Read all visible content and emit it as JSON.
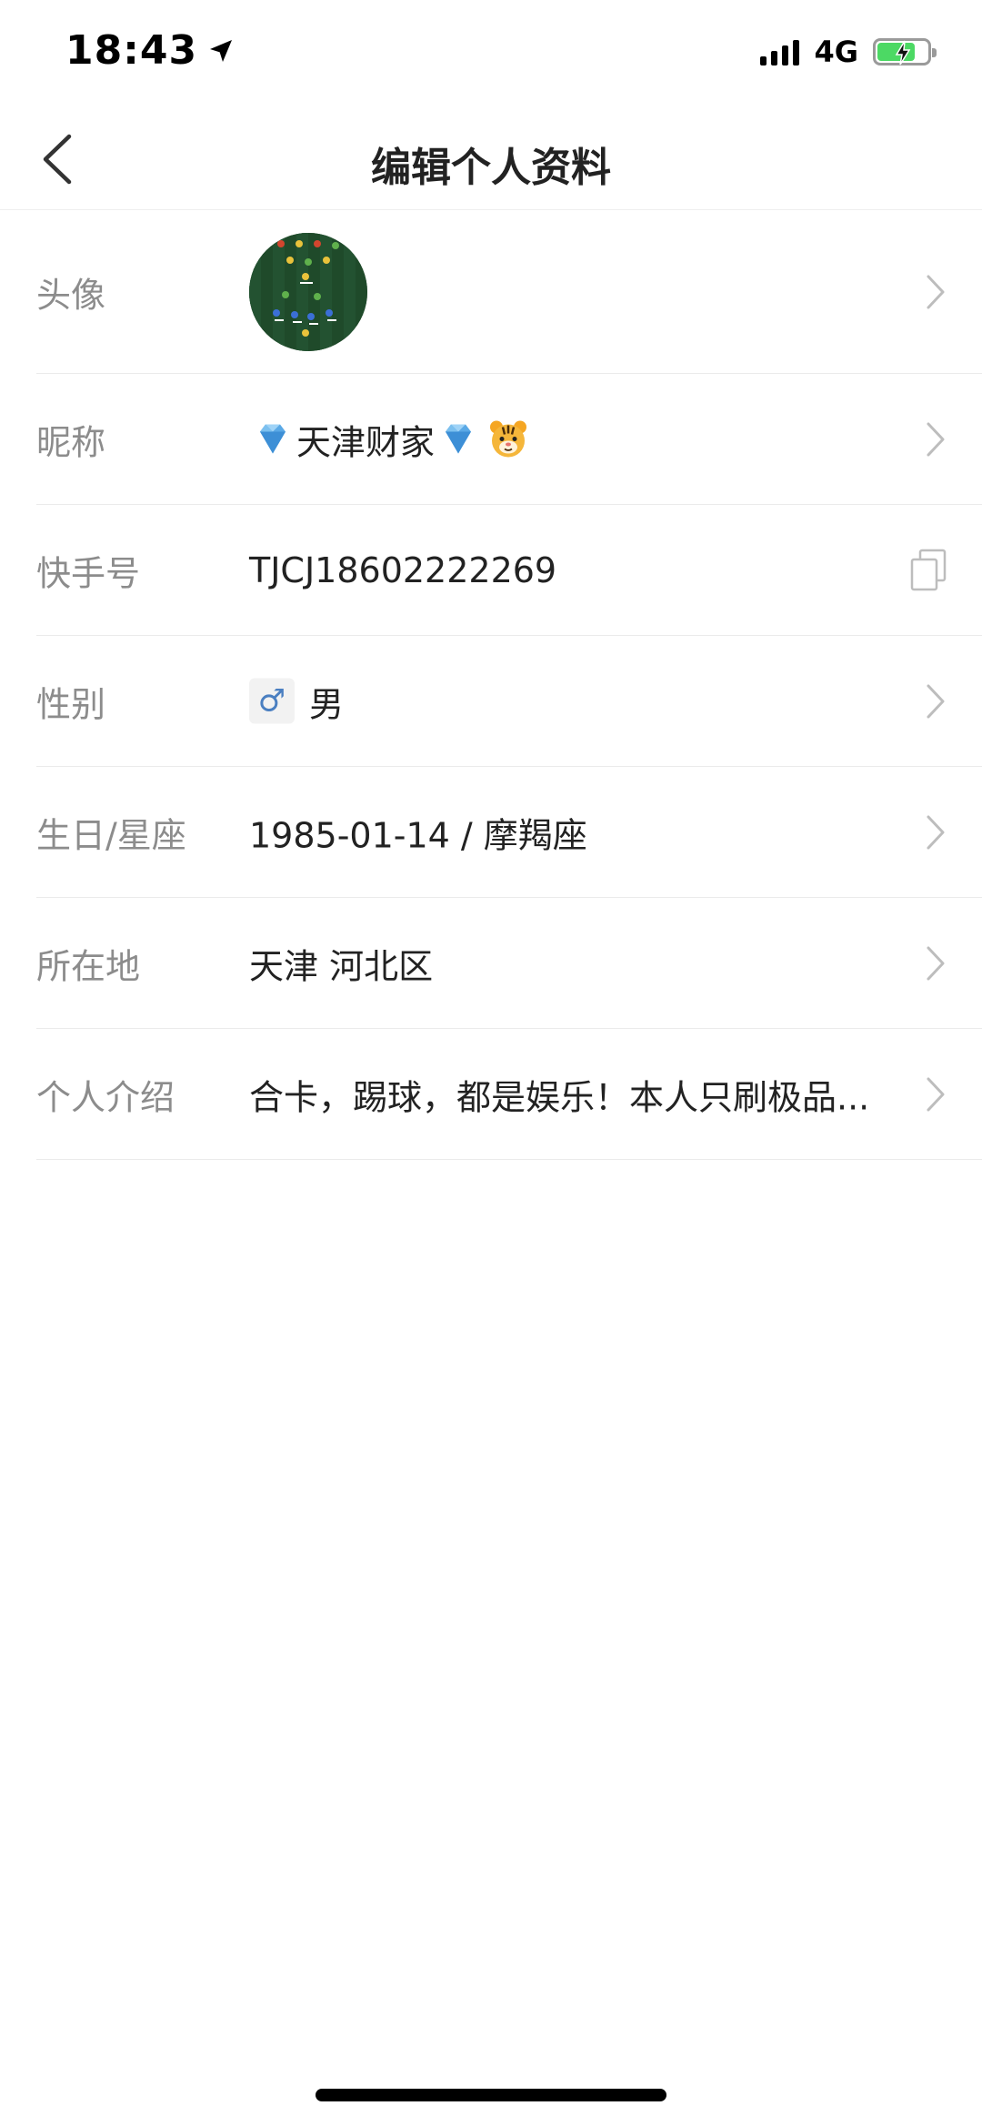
{
  "status_bar": {
    "time": "18:43",
    "network": "4G",
    "battery_color": "#4cd964"
  },
  "nav": {
    "title": "编辑个人资料",
    "back_icon": "chevron-left-icon"
  },
  "rows": [
    {
      "key": "avatar",
      "label": "头像",
      "action_icon": "chevron-right-icon"
    },
    {
      "key": "nickname",
      "label": "昵称",
      "value_left_emoji": "gem-icon",
      "value": "天津财家",
      "value_right_emoji": "gem-icon",
      "tail_emoji": "tiger-icon",
      "action_icon": "chevron-right-icon"
    },
    {
      "key": "kuaishou_id",
      "label": "快手号",
      "value": "TJCJ18602222269",
      "action_icon": "copy-icon"
    },
    {
      "key": "gender",
      "label": "性别",
      "gender_symbol": "♂",
      "value": "男",
      "action_icon": "chevron-right-icon"
    },
    {
      "key": "birthday",
      "label": "生日/星座",
      "value": "1985-01-14 / 摩羯座",
      "action_icon": "chevron-right-icon"
    },
    {
      "key": "location",
      "label": "所在地",
      "value": "天津 河北区",
      "action_icon": "chevron-right-icon"
    },
    {
      "key": "intro",
      "label": "个人介绍",
      "value": "合卡，踢球，都是娱乐！本人只刷极品...",
      "action_icon": "chevron-right-icon"
    }
  ],
  "colors": {
    "label_gray": "#8c8c8c",
    "divider": "#ebebeb",
    "gender_blue": "#4a7fc1"
  }
}
